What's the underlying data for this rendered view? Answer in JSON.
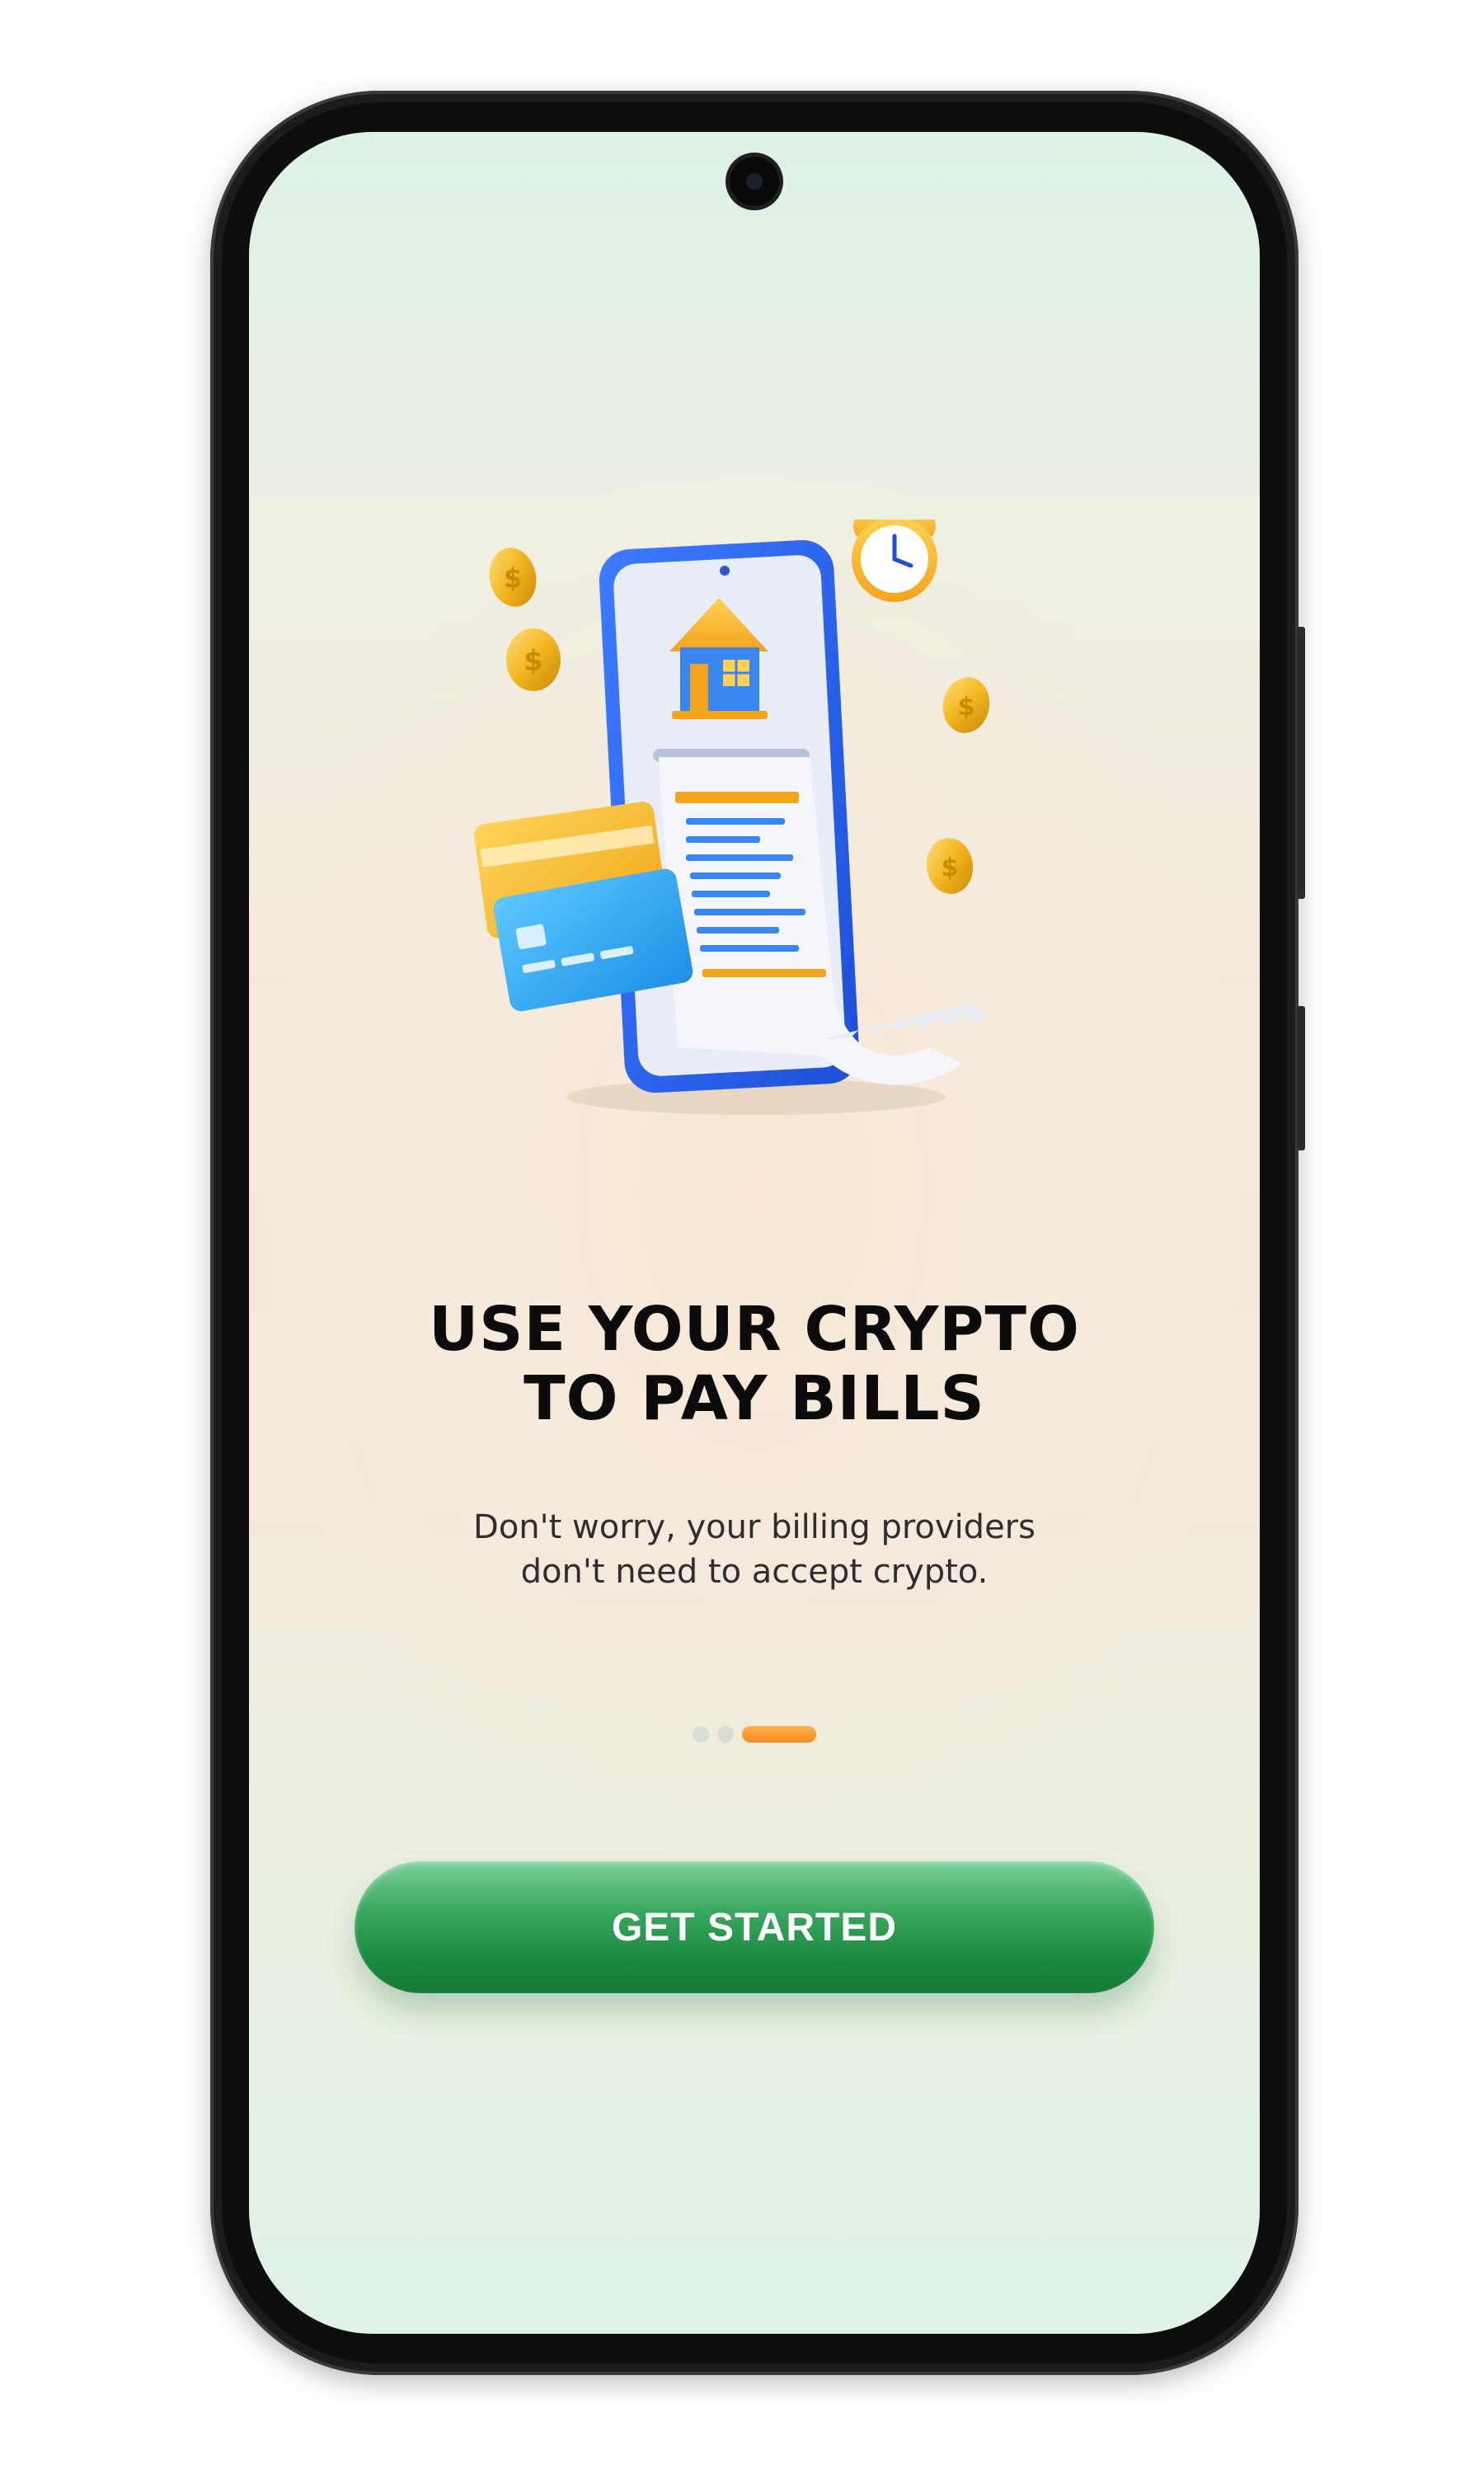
{
  "onboarding": {
    "title_lines": [
      "USE YOUR CRYPTO",
      "TO PAY BILLS"
    ],
    "subtitle_lines": [
      "Don't worry, your billing providers",
      "don't need to accept crypto."
    ],
    "cta_label": "GET STARTED",
    "pager": {
      "total": 3,
      "active_index": 2
    }
  },
  "illustration": {
    "icons": [
      "phone-icon",
      "house-icon",
      "receipt-icon",
      "credit-card-icon",
      "alarm-clock-icon",
      "coin-icon"
    ]
  },
  "colors": {
    "accent_green": "#1a8a3d",
    "pager_active": "#f58a1f",
    "pager_inactive": "#d9dcd7",
    "title_text": "#0b0b0b"
  }
}
